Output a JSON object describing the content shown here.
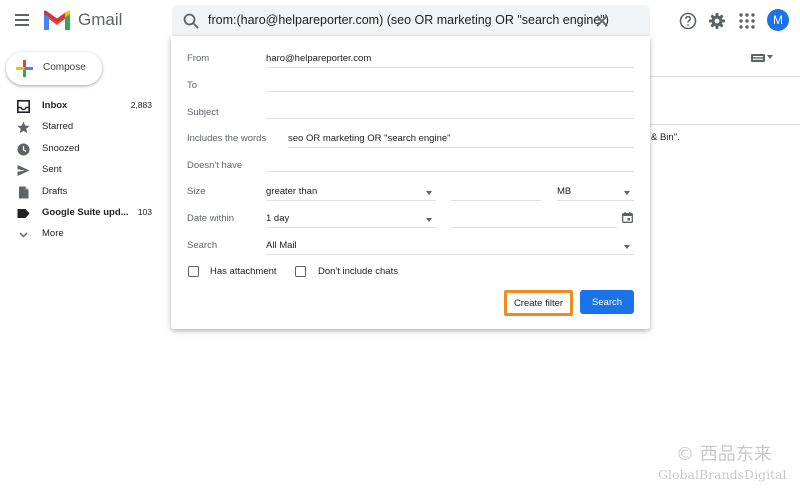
{
  "header": {
    "app_name": "Gmail",
    "search_query": "from:(haro@helpareporter.com) (seo OR marketing OR \"search engine\")",
    "avatar_letter": "M",
    "brand_colors": {
      "red": "#ea4335",
      "blue": "#4285f4",
      "green": "#34a853",
      "yellow": "#fbbc04"
    }
  },
  "sidebar": {
    "compose_label": "Compose",
    "items": [
      {
        "label": "Inbox",
        "count": "2,883",
        "icon": "inbox-icon",
        "bold": true
      },
      {
        "label": "Starred",
        "count": "",
        "icon": "star-icon",
        "bold": false
      },
      {
        "label": "Snoozed",
        "count": "",
        "icon": "clock-icon",
        "bold": false
      },
      {
        "label": "Sent",
        "count": "",
        "icon": "send-icon",
        "bold": false
      },
      {
        "label": "Drafts",
        "count": "",
        "icon": "draft-icon",
        "bold": false
      },
      {
        "label": "Google Suite upd...",
        "count": "103",
        "icon": "label-icon",
        "bold": true
      },
      {
        "label": "More",
        "count": "",
        "icon": "chevron-down-icon",
        "bold": false
      }
    ]
  },
  "background": {
    "snippet": "& Bin\"."
  },
  "search_panel": {
    "from_label": "From",
    "from_value": "haro@helpareporter.com",
    "to_label": "To",
    "to_value": "",
    "subject_label": "Subject",
    "subject_value": "",
    "includes_label": "Includes the words",
    "includes_value": "seo OR marketing OR \"search engine\"",
    "doesnt_have_label": "Doesn't have",
    "doesnt_have_value": "",
    "size_label": "Size",
    "size_operator": "greater than",
    "size_value": "",
    "size_unit": "MB",
    "date_label": "Date within",
    "date_value": "1 day",
    "date_date": "",
    "search_in_label": "Search",
    "search_in_value": "All Mail",
    "has_attachment_label": "Has attachment",
    "no_chats_label": "Don't include chats",
    "create_filter_label": "Create filter",
    "search_button_label": "Search",
    "highlight_color": "#f28b1e",
    "button_color": "#1a73e8"
  },
  "watermark": {
    "line1": "© 西品东来",
    "line2": "GlobalBrandsDigital"
  }
}
